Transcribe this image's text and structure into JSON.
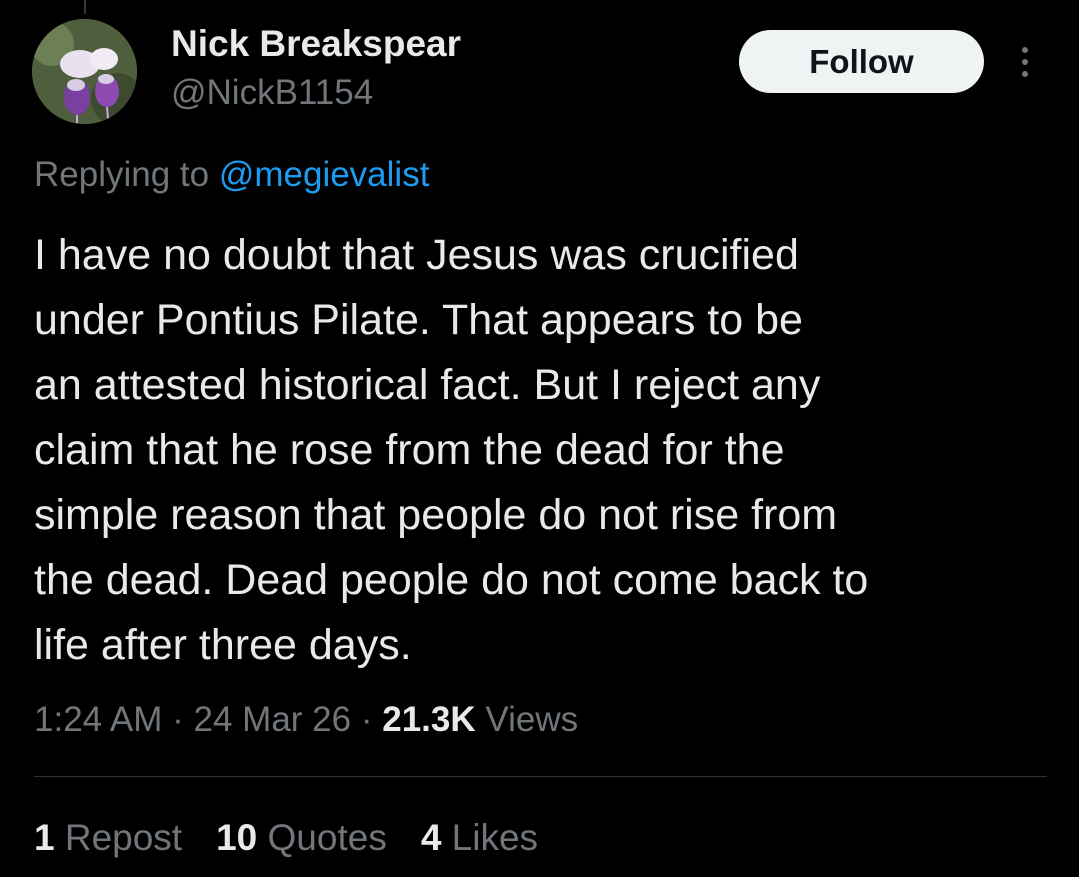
{
  "author": {
    "display_name": "Nick Breakspear",
    "handle": "@NickB1154"
  },
  "actions": {
    "follow_label": "Follow"
  },
  "reply": {
    "prefix": "Replying to ",
    "mention": "@megievalist"
  },
  "tweet": {
    "lines": [
      "I have no doubt that Jesus was crucified",
      "under Pontius Pilate. That appears to be",
      "an attested historical fact. But I reject any",
      "claim that he rose from the dead for the",
      "simple reason that people do not rise from",
      "the dead. Dead people do not come back to",
      "life after three days."
    ]
  },
  "meta": {
    "time": "1:24 AM",
    "separator": " · ",
    "date": "24 Mar 26",
    "views_count": "21.3K",
    "views_label": " Views"
  },
  "stats": {
    "reposts_count": "1",
    "reposts_label": " Repost",
    "quotes_count": "10",
    "quotes_label": " Quotes",
    "likes_count": "4",
    "likes_label": " Likes"
  },
  "icons": {
    "more": "more-horizontal-icon"
  },
  "colors": {
    "background": "#000000",
    "text_primary": "#e7e9ea",
    "text_secondary": "#71767b",
    "link": "#1d9bf0",
    "follow_bg": "#eff3f4",
    "follow_text": "#0f1419",
    "divider": "#2f3336"
  }
}
